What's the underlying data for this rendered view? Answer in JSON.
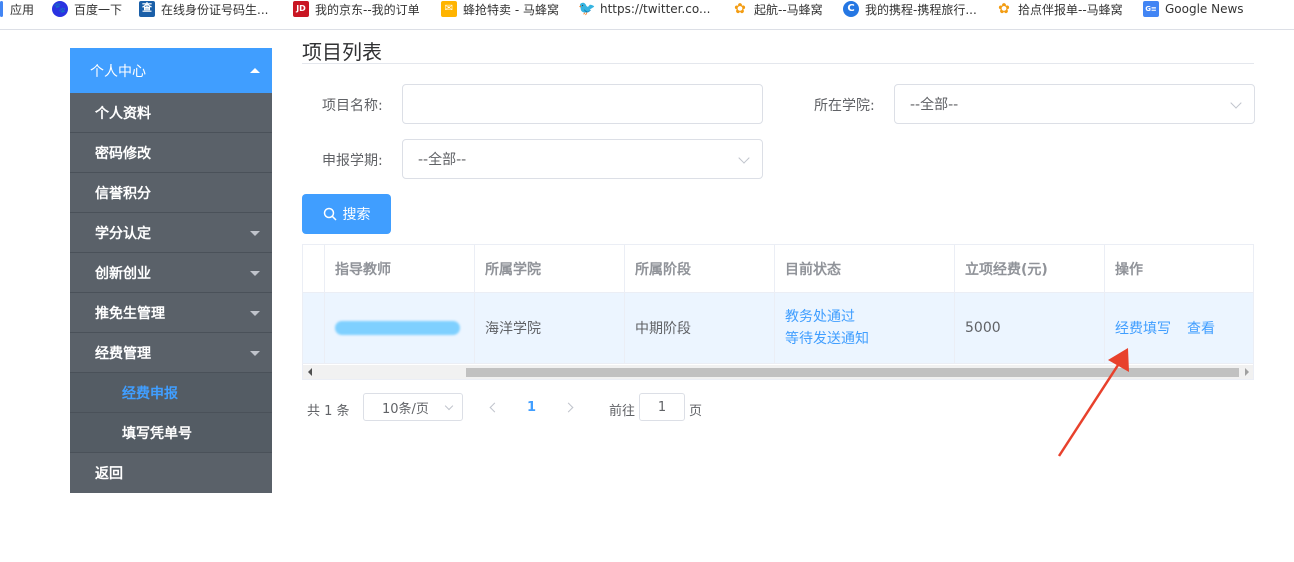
{
  "bookmarks": [
    {
      "label": "应用",
      "icon": "apps-icon",
      "color": "#4285f4"
    },
    {
      "label": "百度一下",
      "icon": "baidu-icon",
      "color": "#2932e1"
    },
    {
      "label": "在线身份证号码生...",
      "icon": "idcard-site-icon",
      "color": "#1a5fa8"
    },
    {
      "label": "我的京东--我的订单",
      "icon": "jd-icon",
      "color": "#c91623"
    },
    {
      "label": "蜂抢特卖 - 马蜂窝",
      "icon": "mafengwo-icon",
      "color": "#ffb400"
    },
    {
      "label": "https://twitter.co...",
      "icon": "twitter-icon",
      "color": "#1da1f2"
    },
    {
      "label": "起航--马蜂窝",
      "icon": "mafengwo-icon",
      "color": "#f39c12"
    },
    {
      "label": "我的携程-携程旅行...",
      "icon": "ctrip-icon",
      "color": "#2577e3"
    },
    {
      "label": "拾点伴报单--马蜂窝",
      "icon": "mafengwo-icon",
      "color": "#f39c12"
    },
    {
      "label": "Google News",
      "icon": "google-news-icon",
      "color": "#4285f4"
    }
  ],
  "sidebar": {
    "header": "个人中心",
    "items": [
      {
        "label": "个人资料",
        "expandable": false
      },
      {
        "label": "密码修改",
        "expandable": false
      },
      {
        "label": "信誉积分",
        "expandable": false
      },
      {
        "label": "学分认定",
        "expandable": true
      },
      {
        "label": "创新创业",
        "expandable": true
      },
      {
        "label": "推免生管理",
        "expandable": true
      },
      {
        "label": "经费管理",
        "expandable": true
      },
      {
        "label": "经费申报",
        "sub": true,
        "active": true
      },
      {
        "label": "填写凭单号",
        "sub": true
      },
      {
        "label": "返回",
        "expandable": false
      }
    ]
  },
  "main": {
    "title": "项目列表",
    "filters": {
      "project_name_label": "项目名称:",
      "project_name_value": "",
      "college_label": "所在学院:",
      "college_value": "--全部--",
      "term_label": "申报学期:",
      "term_value": "--全部--"
    },
    "search_label": "搜索"
  },
  "table": {
    "columns": [
      "指导教师",
      "所属学院",
      "所属阶段",
      "目前状态",
      "立项经费(元)",
      "操作"
    ],
    "rows": [
      {
        "teacher": "",
        "college": "海洋学院",
        "stage": "中期阶段",
        "status_line1": "教务处通过",
        "status_line2": "等待发送通知",
        "funding": "5000",
        "action_fill": "经费填写",
        "action_view": "查看"
      }
    ]
  },
  "pagination": {
    "total": "共 1 条",
    "page_size": "10条/页",
    "current_page": "1",
    "goto_label": "前往",
    "goto_value": "1",
    "page_suffix": "页"
  },
  "colors": {
    "primary": "#409eff",
    "sidebar_bg": "#545c64",
    "annotation_arrow": "#e8412c"
  }
}
